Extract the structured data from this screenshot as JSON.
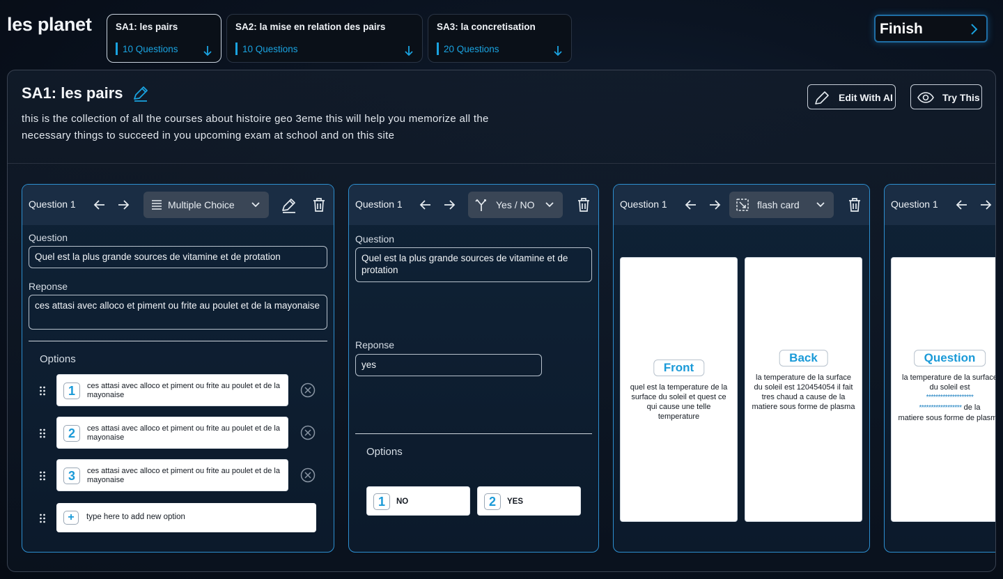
{
  "app": {
    "logo": "les planet"
  },
  "sa_tabs": [
    {
      "title": "SA1: les pairs",
      "count": "10 Questions"
    },
    {
      "title": "SA2: la mise en relation des pairs",
      "count": "10 Questions"
    },
    {
      "title": "SA3: la concretisation",
      "count": "20 Questions"
    }
  ],
  "finish": {
    "label": "Finish"
  },
  "panel": {
    "title": "SA1: les pairs",
    "description": "this is the collection of all the courses about histoire geo 3eme this will help you memorize all the necessary things to succeed in you upcoming exam at school and on this site",
    "edit_ai_label": "Edit With AI",
    "try_label": "Try This"
  },
  "cards": [
    {
      "label": "Question 1",
      "type": "Multiple Choice",
      "question_label": "Question",
      "question": "Quel est la plus grande sources de vitamine et de protation",
      "answer_label": "Reponse",
      "answer": "ces attasi avec alloco et piment  ou frite au poulet et de la mayonaise",
      "options_label": "Options",
      "options": [
        {
          "num": "1",
          "text": "ces attasi avec alloco et piment  ou frite au poulet et de la mayonaise"
        },
        {
          "num": "2",
          "text": "ces attasi avec alloco et piment  ou frite au poulet et de la mayonaise"
        },
        {
          "num": "3",
          "text": "ces attasi avec alloco et piment  ou frite au poulet et de la mayonaise"
        }
      ],
      "add_option": {
        "symbol": "+",
        "placeholder": "type here to add new option"
      }
    },
    {
      "label": "Question 1",
      "type": "Yes / NO",
      "question_label": "Question",
      "question": "Quel est la plus grande sources de vitamine et de protation",
      "answer_label": "Reponse",
      "answer": "yes",
      "options_label": "Options",
      "options": [
        {
          "num": "1",
          "text": "NO"
        },
        {
          "num": "2",
          "text": "YES"
        }
      ]
    },
    {
      "label": "Question 1",
      "type": "flash card",
      "front_tag": "Front",
      "front_text": "quel est la temperature de la surface du soleil et quest ce qui cause une telle temperature",
      "back_tag": "Back",
      "back_text": "la temperature de la surface du soleil est 120454054 il fait tres chaud a cause de la matiere sous forme de plasma"
    },
    {
      "label": "Question 1",
      "question_tag": "Question",
      "text_before": "la temperature de la surface du soleil est",
      "mask_1": "********************",
      "mask_2": "******************",
      "text_after_mask": "de la",
      "text_end": "matiere sous forme de plasma"
    }
  ],
  "colors": {
    "accent": "#1aa3e0",
    "card_border": "#2d8fd0",
    "background": "#0b1422"
  },
  "icons": [
    "arrow-down-icon",
    "chevron-right-icon",
    "pencil-icon",
    "eye-icon",
    "arrow-left-icon",
    "arrow-right-icon",
    "list-icon",
    "split-icon",
    "flashcard-icon",
    "chevron-down-icon",
    "trash-icon",
    "drag-handle-icon",
    "close-circle-icon"
  ]
}
